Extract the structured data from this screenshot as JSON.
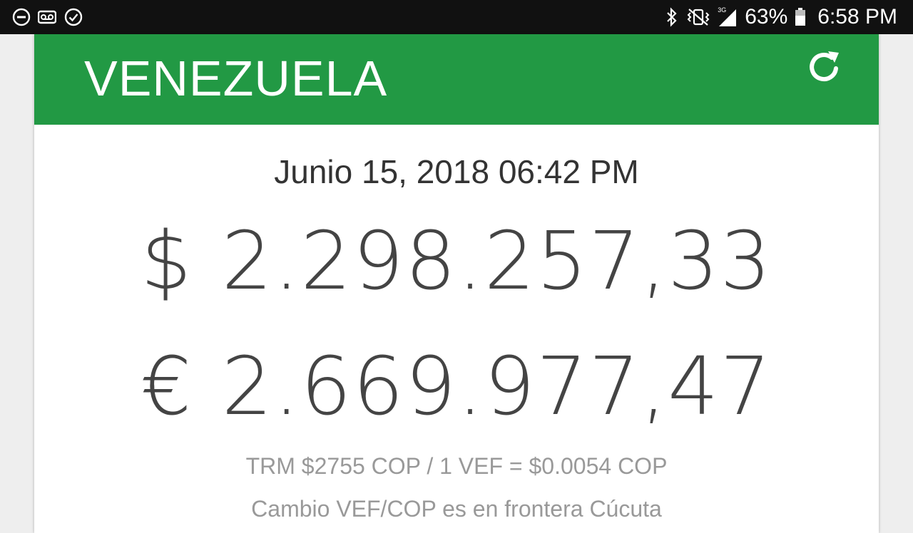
{
  "status_bar": {
    "left_icons": [
      "do-not-disturb-icon",
      "voicemail-icon",
      "check-circle-icon"
    ],
    "right_icons": [
      "bluetooth-icon",
      "vibrate-icon",
      "signal-3g-icon",
      "battery-icon"
    ],
    "network_label": "3G",
    "battery_percent": "63%",
    "time": "6:58 PM"
  },
  "header": {
    "country": "VENEZUELA",
    "refresh_icon": "refresh-icon",
    "background_color": "#229944"
  },
  "main": {
    "date": "Junio 15, 2018 06:42 PM",
    "usd": {
      "symbol": "$",
      "value": "2.298.257,33"
    },
    "eur": {
      "symbol": "€",
      "value": "2.669.977,47"
    },
    "trm_note": "TRM $2755 COP / 1 VEF = $0.0054 COP",
    "border_note": "Cambio VEF/COP es en frontera Cúcuta"
  }
}
